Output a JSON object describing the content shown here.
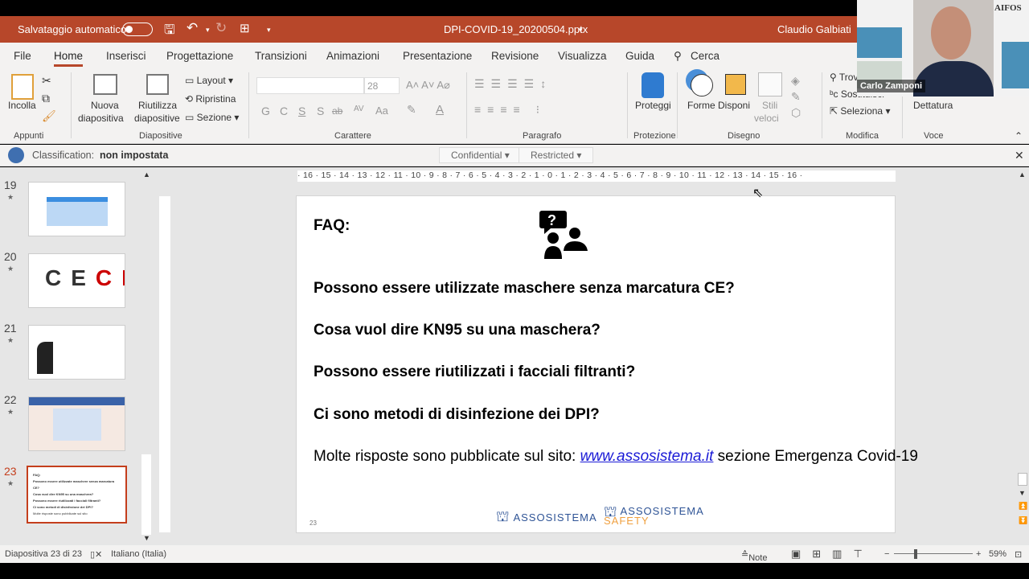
{
  "titlebar": {
    "autosave_label": "Salvataggio automatico",
    "autosave_on": false,
    "filename": "DPI-COVID-19_20200504.pptx",
    "user": "Claudio Galbiati",
    "accent": "#b7472a"
  },
  "tabs": [
    "File",
    "Home",
    "Inserisci",
    "Progettazione",
    "Transizioni",
    "Animazioni",
    "Presentazione",
    "Revisione",
    "Visualizza",
    "Guida"
  ],
  "active_tab": "Home",
  "search_label": "Cerca",
  "ribbon": {
    "appunti": {
      "incolla": "Incolla",
      "group": "Appunti"
    },
    "diapositive": {
      "nuova1": "Nuova",
      "nuova2": "diapositiva",
      "riutilizza1": "Riutilizza",
      "riutilizza2": "diapositive",
      "layout": "Layout",
      "ripristina": "Ripristina",
      "sezione": "Sezione",
      "group": "Diapositive"
    },
    "carattere": {
      "font_size": "28",
      "bold": "G",
      "italic": "C",
      "underline": "S",
      "shadow": "S",
      "strike": "ab",
      "spacing": "AV",
      "case": "Aa",
      "group": "Carattere"
    },
    "paragrafo": {
      "group": "Paragrafo"
    },
    "protezione": {
      "proteggi": "Proteggi",
      "group": "Protezione"
    },
    "disegno": {
      "forme": "Forme",
      "disponi": "Disponi",
      "stili1": "Stili",
      "stili2": "veloci",
      "group": "Disegno"
    },
    "modifica": {
      "trova": "Trova",
      "sostituisci": "Sostituisci",
      "seleziona": "Seleziona",
      "group": "Modifica"
    },
    "voce": {
      "dettatura": "Dettatura",
      "group": "Voce"
    }
  },
  "classification": {
    "label": "Classification:",
    "value": "non impostata",
    "btn1": "Confidential",
    "btn2": "Restricted"
  },
  "thumbnails": [
    {
      "num": "19"
    },
    {
      "num": "20"
    },
    {
      "num": "21"
    },
    {
      "num": "22"
    },
    {
      "num": "23",
      "selected": true
    }
  ],
  "ruler": "· 16 · 15 · 14 · 13 · 12 · 11 · 10 · 9 · 8 · 7 · 6 · 5 · 4 · 3 · 2 · 1 · 0 · 1 · 2 · 3 · 4 · 5 · 6 · 7 · 8 · 9 · 10 · 11 · 12 · 13 · 14 · 15 · 16 ·",
  "slide": {
    "title": "FAQ:",
    "questions": [
      "Possono essere utilizzate maschere senza marcatura CE?",
      "Cosa vuol dire KN95 su una maschera?",
      "Possono essere riutilizzati i facciali filtranti?",
      "Ci sono metodi di disinfezione dei DPI?"
    ],
    "answer_prefix": "Molte risposte sono pubblicate sul sito: ",
    "answer_link": "www.assosistema.it",
    "answer_suffix": " sezione Emergenza Covid-19",
    "slide_number": "23",
    "logo1": "ASSOSISTEMA",
    "logo2": "ASSOSISTEMA",
    "logo2_sub": "SAFETY"
  },
  "statusbar": {
    "slide_info": "Diapositiva 23 di 23",
    "language": "Italiano (Italia)",
    "notes": "Note",
    "zoom": "59%"
  },
  "webcam": {
    "participant": "Carlo Zamponi",
    "brand": "AIFOS"
  }
}
